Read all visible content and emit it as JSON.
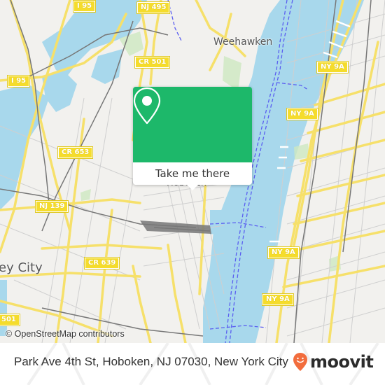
{
  "map": {
    "colors": {
      "land": "#f2f1ee",
      "water": "#a8d8ec",
      "park": "#cde8c0",
      "road_major": "#f6e06a",
      "road_minor": "#cfcfcf",
      "rail": "#777777",
      "ferry": "#5a5ef0"
    },
    "route_shields": [
      {
        "label": "I 95"
      },
      {
        "label": "NJ 495"
      },
      {
        "label": "CR 501"
      },
      {
        "label": "I 95"
      },
      {
        "label": "CR 653"
      },
      {
        "label": "NJ 139"
      },
      {
        "label": "CR 639"
      },
      {
        "label": "501"
      },
      {
        "label": "NY 9A"
      },
      {
        "label": "NY 9A"
      },
      {
        "label": "NY 9A"
      },
      {
        "label": "NY 9A"
      }
    ],
    "place_labels": {
      "weehawken": "Weehawken",
      "hoboken": "Hoboken",
      "jersey_city": "ey City"
    },
    "attribution": "© OpenStreetMap contributors"
  },
  "popup": {
    "icon": "map-pin-icon",
    "button_label": "Take me there",
    "accent_color": "#1db86a"
  },
  "footer": {
    "address": "Park Ave 4th St, Hoboken, NJ 07030, New York City",
    "logo": {
      "icon": "moovit-pin-icon",
      "text": "moovit",
      "color": "#f26d3d"
    }
  }
}
